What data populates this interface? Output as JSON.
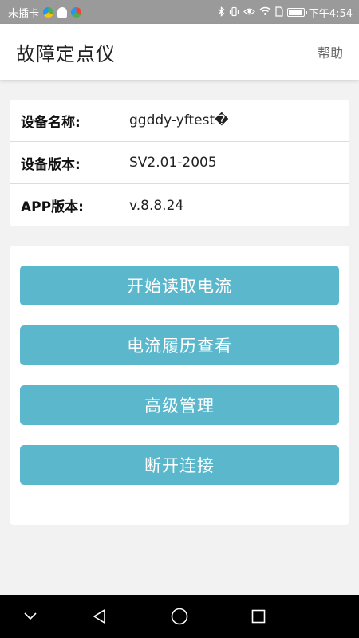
{
  "status_bar": {
    "carrier": "未插卡",
    "time": "下午4:54"
  },
  "app_bar": {
    "title": "故障定点仪",
    "help_label": "帮助"
  },
  "device_info": [
    {
      "label": "设备名称:",
      "value": "ggddy-yftest�"
    },
    {
      "label": "设备版本:",
      "value": "SV2.01-2005"
    },
    {
      "label": "APP版本:",
      "value": "v.8.8.24"
    }
  ],
  "actions": {
    "start_read_current": "开始读取电流",
    "current_history": "电流履历查看",
    "advanced_management": "高级管理",
    "disconnect": "断开连接"
  },
  "colors": {
    "accent": "#5bb8cc",
    "status_bar": "#9a9a9a",
    "background": "#f2f2f2"
  },
  "nav_bar": {
    "icons": [
      "chevron-down-icon",
      "back-icon",
      "home-icon",
      "recent-apps-icon"
    ]
  }
}
